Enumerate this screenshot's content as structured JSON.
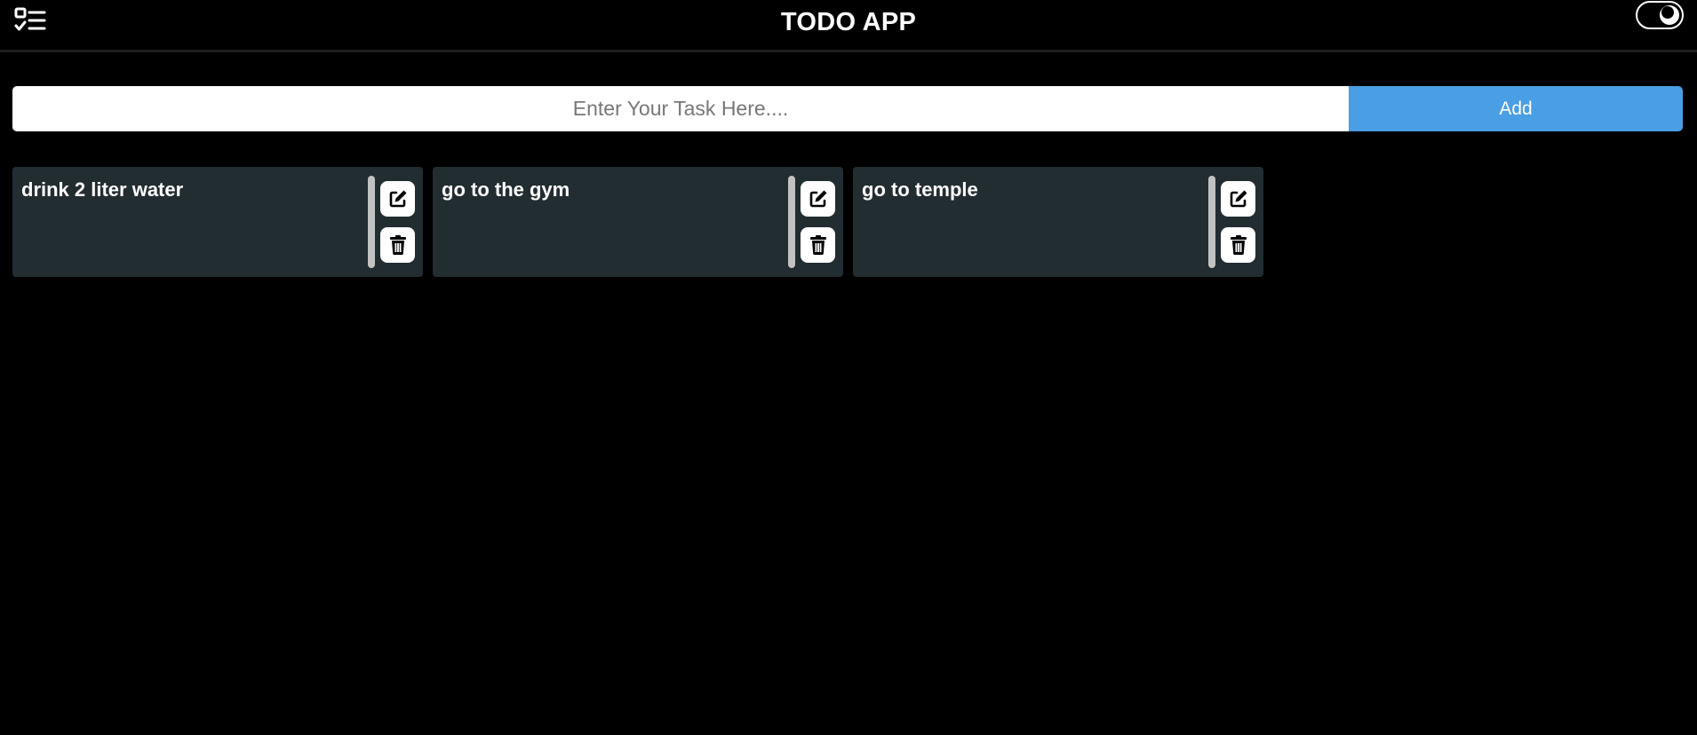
{
  "header": {
    "logo_icon": "task-list-icon",
    "title": "TODO APP",
    "theme_toggle_icon": "moon-icon"
  },
  "add_bar": {
    "input_value": "",
    "input_placeholder": "Enter Your Task Here....",
    "add_label": "Add"
  },
  "tasks": [
    {
      "text": "drink 2 liter water",
      "edit_icon": "edit-icon",
      "delete_icon": "trash-icon"
    },
    {
      "text": "go to the gym",
      "edit_icon": "edit-icon",
      "delete_icon": "trash-icon"
    },
    {
      "text": "go to temple",
      "edit_icon": "edit-icon",
      "delete_icon": "trash-icon"
    }
  ],
  "colors": {
    "background": "#000000",
    "card": "#222d32",
    "accent": "#4a9ee3",
    "text": "#ffffff"
  }
}
